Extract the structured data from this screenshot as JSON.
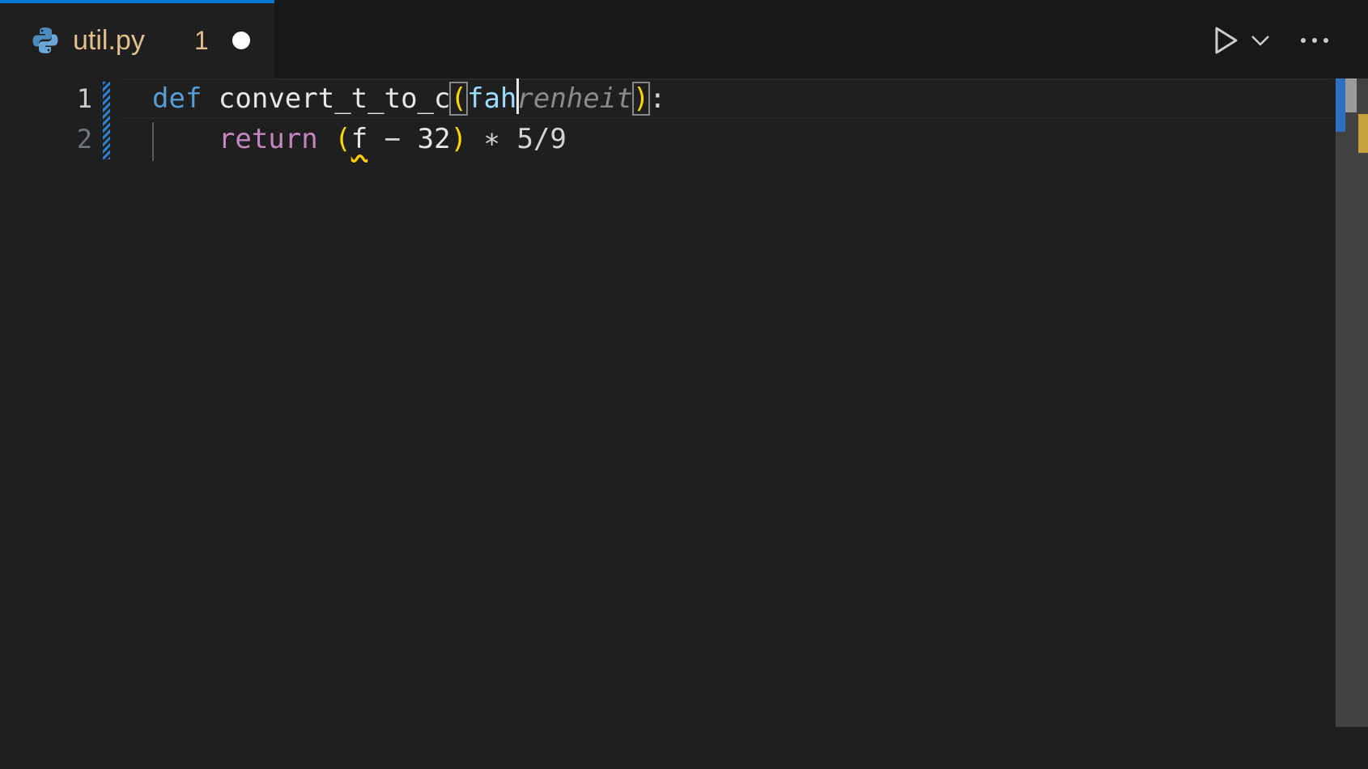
{
  "tab": {
    "icon": "python-icon",
    "filename": "util.py",
    "problem_count": "1",
    "dirty_indicator": "●"
  },
  "toolbar": {
    "run_icon": "play-icon",
    "run_dropdown_icon": "chevron-down-icon",
    "more_icon": "ellipsis-icon"
  },
  "editor": {
    "language": "python",
    "cursor_line": 1,
    "lines": [
      {
        "number": "1",
        "tokens": {
          "def": "def",
          "space1": " ",
          "func_name": "convert_t_to_c",
          "open_paren": "(",
          "param_typed": "fah",
          "ghost_suggestion": "renheit",
          "close_paren": ")",
          "colon": ":"
        }
      },
      {
        "number": "2",
        "tokens": {
          "indent": "    ",
          "return": "return",
          "space1": " ",
          "open_paren": "(",
          "var": "f",
          "minus": " − ",
          "num32": "32",
          "close_paren": ")",
          "rest": " ∗ 5/9"
        }
      }
    ]
  },
  "colors": {
    "background": "#1f1f1f",
    "tab_accent": "#0078d4",
    "filename_modified": "#e2c08d",
    "keyword_def": "#569cd6",
    "keyword_return": "#c586c0",
    "bracket": "#ffd700",
    "parameter": "#9cdcfe",
    "warning_squiggle": "#ffcc00"
  }
}
